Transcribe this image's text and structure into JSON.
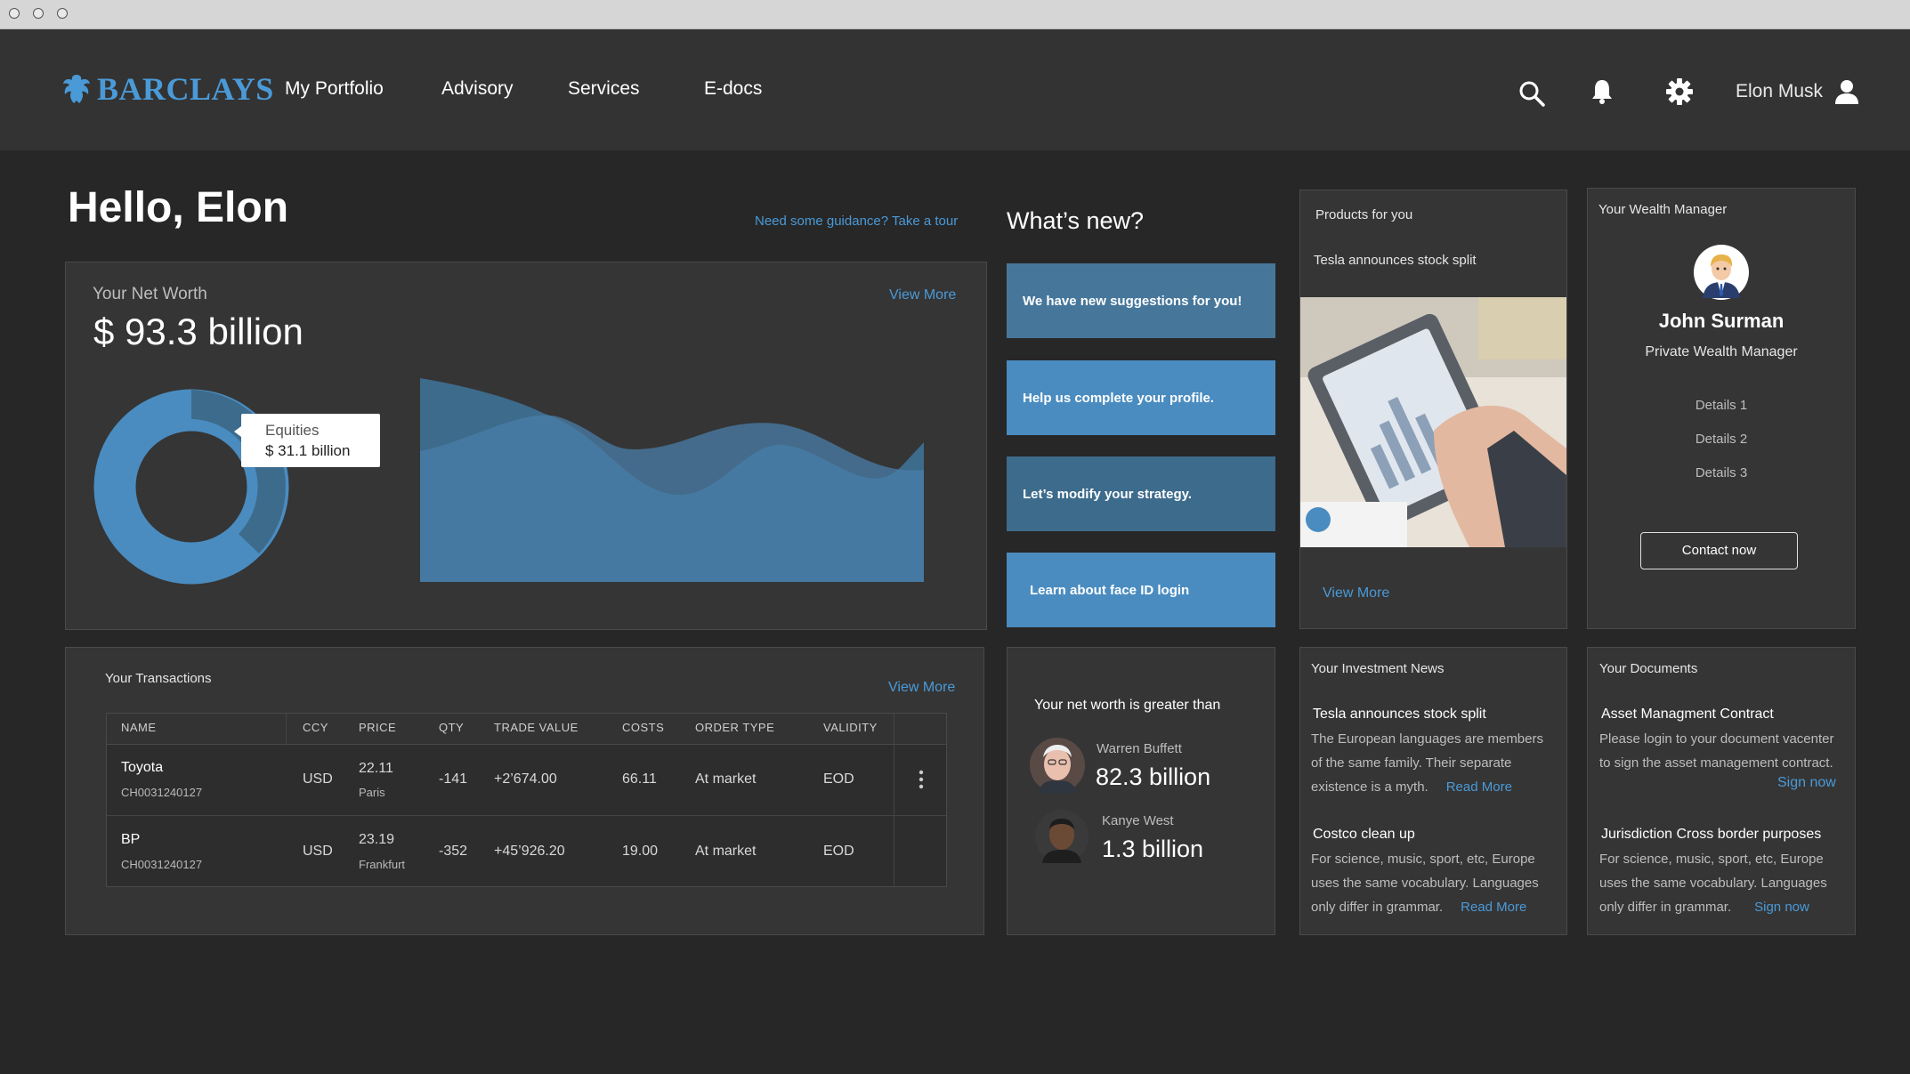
{
  "nav": {
    "brand": "BARCLAYS",
    "links": [
      "My Portfolio",
      "Advisory",
      "Services",
      "E-docs"
    ],
    "user_name": "Elon Musk"
  },
  "greeting": "Hello, Elon",
  "tour_link": "Need some guidance? Take a tour",
  "net_worth": {
    "label": "Your Net Worth",
    "view_more": "View More",
    "value": "$ 93.3 billion",
    "tooltip_label": "Equities",
    "tooltip_value": "$ 31.1 billion"
  },
  "whats_new": {
    "title": "What’s new?",
    "items": [
      "We have new suggestions for you!",
      "Help us complete your profile.",
      "Let’s modify your strategy.",
      "Learn about face ID login"
    ]
  },
  "products": {
    "title": "Products for you",
    "headline": "Tesla announces stock split",
    "view_more": "View More"
  },
  "wealth_manager": {
    "title": "Your Wealth Manager",
    "name": "John Surman",
    "role": "Private Wealth Manager",
    "details": [
      "Details 1",
      "Details 2",
      "Details 3"
    ],
    "contact": "Contact now"
  },
  "transactions": {
    "title": "Your Transactions",
    "view_more": "View More",
    "headers": [
      "NAME",
      "CCY",
      "PRICE",
      "QTY",
      "TRADE VALUE",
      "COSTS",
      "ORDER TYPE",
      "VALIDITY"
    ],
    "rows": [
      {
        "name": "Toyota",
        "id": "CH0031240127",
        "ccy": "USD",
        "price": "22.11",
        "place": "Paris",
        "qty": "-141",
        "trade_value": "+2’674.00",
        "costs": "66.11",
        "order_type": "At market",
        "validity": "EOD"
      },
      {
        "name": "BP",
        "id": "CH0031240127",
        "ccy": "USD",
        "price": "23.19",
        "place": "Frankfurt",
        "qty": "-352",
        "trade_value": "+45’926.20",
        "costs": "19.00",
        "order_type": "At market",
        "validity": "EOD"
      }
    ]
  },
  "comparison": {
    "title": "Your net worth is greater than",
    "people": [
      {
        "name": "Warren Buffett",
        "value": "82.3 billion"
      },
      {
        "name": "Kanye West",
        "value": "1.3 billion"
      }
    ]
  },
  "investment_news": {
    "title": "Your Investment News",
    "items": [
      {
        "headline": "Tesla announces stock split",
        "line1": "The European languages are members",
        "line2": "of the same family. Their separate",
        "line3": "existence is a myth.",
        "link": "Read More"
      },
      {
        "headline": "Costco clean up",
        "line1": "For science, music, sport, etc, Europe",
        "line2": "uses the same vocabulary. Languages",
        "line3": "only differ in grammar.",
        "link": "Read More"
      }
    ]
  },
  "documents": {
    "title": "Your Documents",
    "items": [
      {
        "headline": "Asset Managment Contract",
        "line1": "Please login to your document vacenter",
        "line2": "to sign the asset management contract.",
        "link": "Sign now"
      },
      {
        "headline": "Jurisdiction Cross border purposes",
        "line1": "For science, music, sport, etc, Europe",
        "line2": "uses the same vocabulary. Languages",
        "line3": "only differ in grammar.",
        "link": "Sign now"
      }
    ]
  },
  "colors": {
    "accent": "#4a9ad8",
    "page_bg": "#272727",
    "card_bg": "#353535",
    "navbar_bg": "#333333",
    "suggestion_dark": "#3d6b8c",
    "suggestion_light": "#4a8cc0"
  },
  "icons": [
    "search-icon",
    "bell-icon",
    "gear-icon",
    "user-icon",
    "more-vertical-icon"
  ]
}
